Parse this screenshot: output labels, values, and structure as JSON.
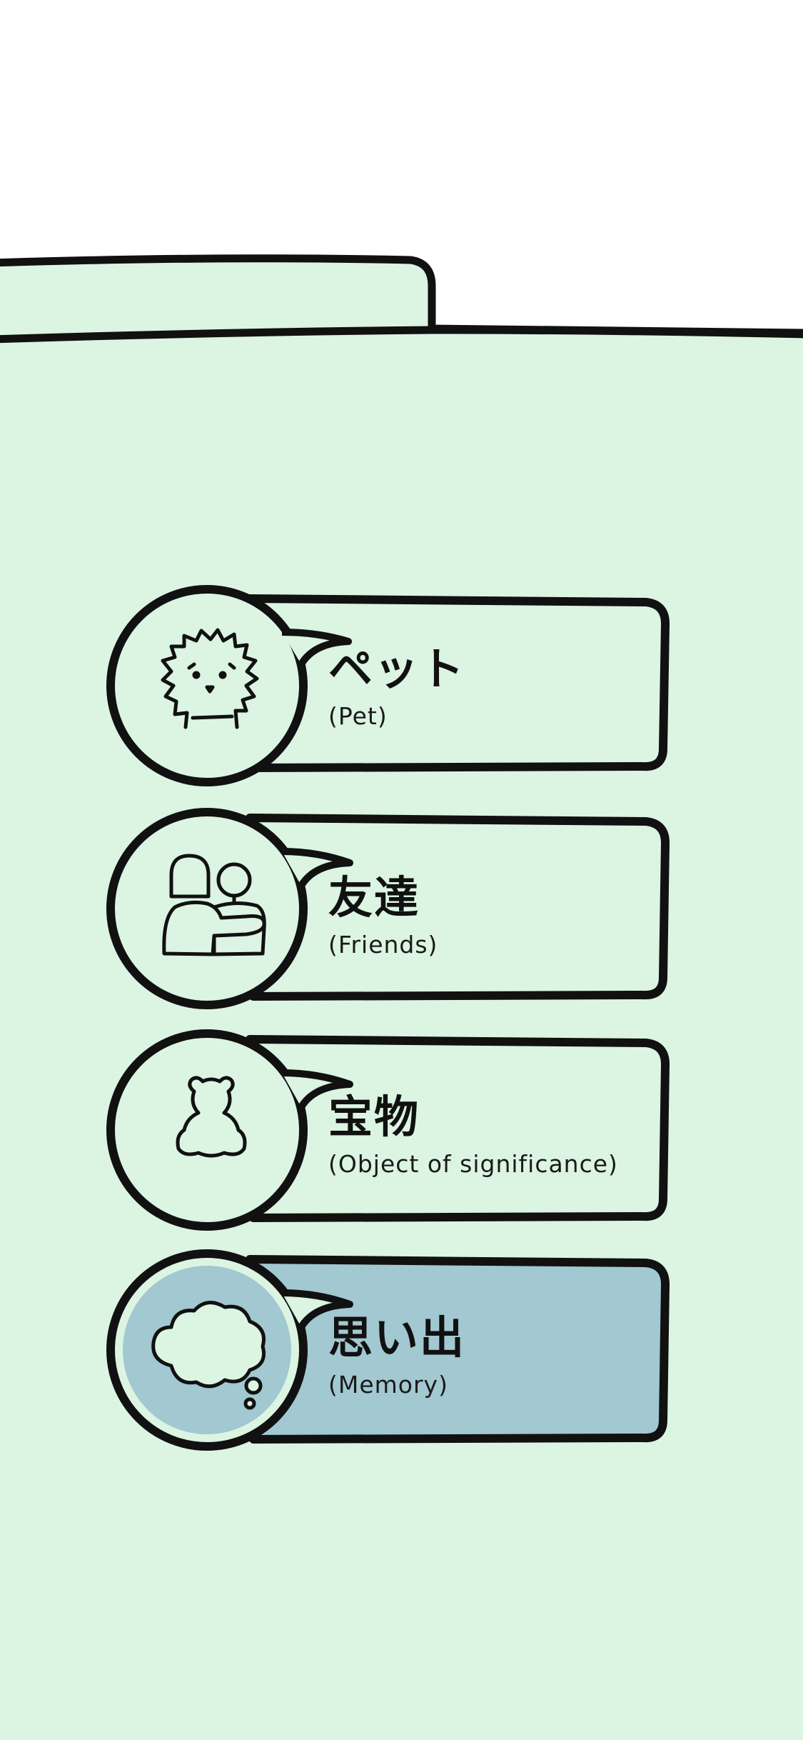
{
  "colors": {
    "background": "#dcf4e2",
    "outline": "#111111",
    "selected_fill": "#a2c8d1",
    "white": "#ffffff"
  },
  "categories": [
    {
      "title": "ペット",
      "subtitle": "(Pet)",
      "icon": "hedgehog-icon",
      "selected": false
    },
    {
      "title": "友達",
      "subtitle": "(Friends)",
      "icon": "friends-icon",
      "selected": false
    },
    {
      "title": "宝物",
      "subtitle": "(Object of significance)",
      "icon": "teddy-bear-icon",
      "selected": false
    },
    {
      "title": "思い出",
      "subtitle": "(Memory)",
      "icon": "thought-cloud-icon",
      "selected": true
    }
  ]
}
